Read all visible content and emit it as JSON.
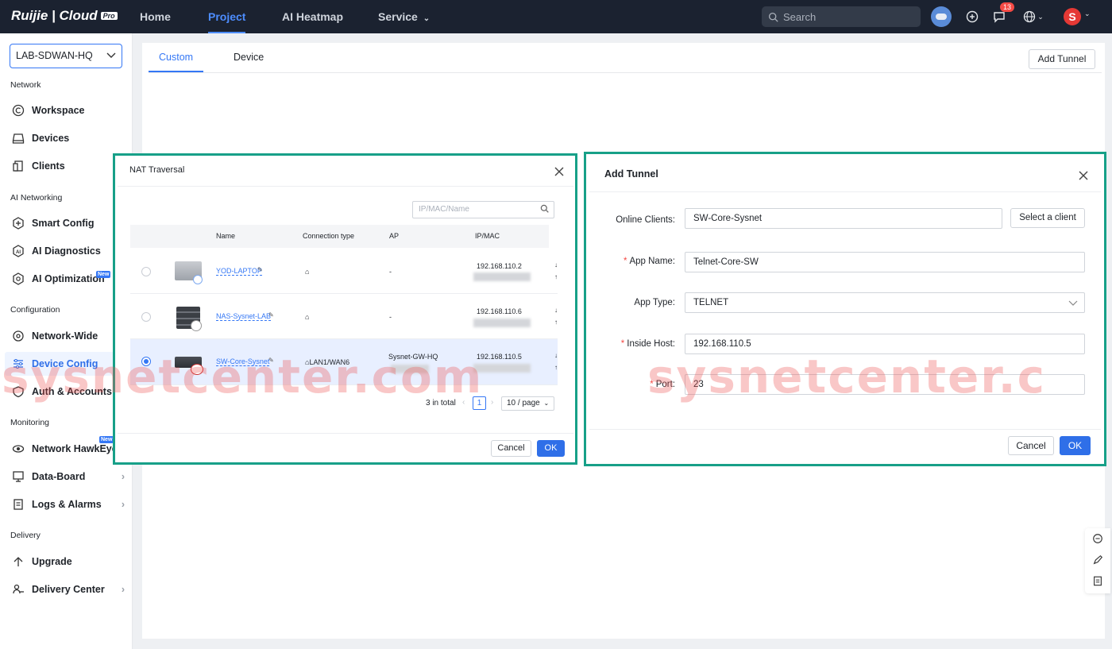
{
  "topbar": {
    "logo_text": "Ruijie | Cloud",
    "logo_badge": "Pro",
    "nav": [
      "Home",
      "Project",
      "AI Heatmap",
      "Service"
    ],
    "active_nav": "Project",
    "search_placeholder": "Search",
    "message_badge": "13",
    "avatar_letter": "S"
  },
  "sidebar": {
    "project": "LAB-SDWAN-HQ",
    "sections": {
      "network": "Network",
      "ai_networking": "AI Networking",
      "configuration": "Configuration",
      "monitoring": "Monitoring",
      "delivery": "Delivery"
    },
    "items": {
      "workspace": "Workspace",
      "devices": "Devices",
      "clients": "Clients",
      "smart_config": "Smart Config",
      "ai_diagnostics": "AI Diagnostics",
      "ai_optimization": "AI Optimization",
      "network_wide": "Network-Wide",
      "device_config": "Device Config",
      "auth_accounts": "Auth & Accounts",
      "network_hawkeye": "Network HawkEye",
      "data_board": "Data-Board",
      "logs_alarms": "Logs & Alarms",
      "upgrade": "Upgrade",
      "delivery_center": "Delivery Center"
    },
    "new_tag": "New"
  },
  "main": {
    "tabs": [
      "Custom",
      "Device"
    ],
    "active_tab": "Custom",
    "add_tunnel_button": "Add Tunnel"
  },
  "nat_dialog": {
    "title": "NAT Traversal",
    "filter_placeholder": "IP/MAC/Name",
    "columns": [
      "Name",
      "Connection type",
      "AP",
      "IP/MAC"
    ],
    "rows": [
      {
        "name": "YOD-LAPTOP",
        "connection": "",
        "ap": "-",
        "ip": "192.168.110.2",
        "selected": false
      },
      {
        "name": "NAS-Sysnet-LAB",
        "connection": "",
        "ap": "-",
        "ip": "192.168.110.6",
        "selected": false
      },
      {
        "name": "SW-Core-Sysnet",
        "connection": "LAN1/WAN6",
        "ap": "Sysnet-GW-HQ",
        "ip": "192.168.110.5",
        "selected": true
      }
    ],
    "total": "3 in total",
    "page": "1",
    "page_size": "10 / page",
    "cancel": "Cancel",
    "ok": "OK"
  },
  "add_tunnel_dialog": {
    "title": "Add Tunnel",
    "online_clients_label": "Online Clients:",
    "online_clients_value": "SW-Core-Sysnet",
    "select_client_button": "Select a client",
    "app_name_label": "App Name:",
    "app_name_value": "Telnet-Core-SW",
    "app_type_label": "App Type:",
    "app_type_value": "TELNET",
    "inside_host_label": "Inside Host:",
    "inside_host_value": "192.168.110.5",
    "port_label": "Port:",
    "port_value": "23",
    "cancel": "Cancel",
    "ok": "OK"
  },
  "watermark_left": "sysnetcenter.com",
  "watermark_right": "sysnetcenter.c",
  "colors": {
    "topbar": "#1b2230",
    "accent": "#2f6fe8",
    "frame": "#17a088",
    "watermark": "#ec5050"
  }
}
